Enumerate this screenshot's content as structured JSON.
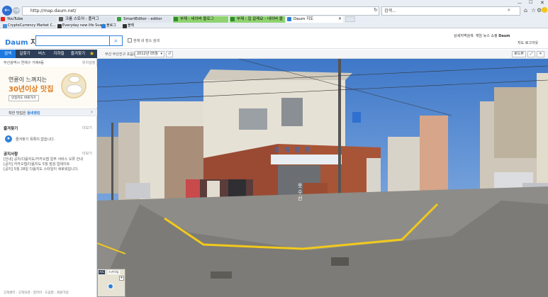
{
  "browser": {
    "address_url": "http://map.daum.net/",
    "search_placeholder": "검색...",
    "tabs": [
      {
        "label": "YouTube",
        "color": "#e62117"
      },
      {
        "label": "크롬 스토어 - 플러그",
        "color": "#555"
      },
      {
        "label": "SmartEditor - editor",
        "color": "#3ca03c"
      },
      {
        "label": "부제 : 네이버 블로그",
        "color": "#3ca03c"
      },
      {
        "label": "부제 : 집 갈래요 - 네이버 블",
        "color": "#3ca03c"
      },
      {
        "label": "Daum 지도",
        "color": "#2f7fd6"
      }
    ],
    "favorites": [
      {
        "label": "CryptoCurrency Market C...",
        "color": "#4a90d9"
      },
      {
        "label": "Everyday new life Svart",
        "color": "#333"
      },
      {
        "label": "블로그",
        "color": "#2f7fd6"
      },
      {
        "label": "블랙",
        "color": "#333"
      }
    ]
  },
  "daum": {
    "logo_prefix": "Daum",
    "logo_suffix": "지도",
    "checkbox_label": "현재 내 장소 검색",
    "nav_links": [
      "상세지역검색",
      "게임",
      "뉴스",
      "쇼핑",
      "Daum"
    ],
    "nav_links_2": [
      "지도",
      "로그아웃"
    ]
  },
  "sidebar": {
    "tabs": [
      "검색",
      "길찾기",
      "버스",
      "지하철",
      "즐겨찾기"
    ],
    "location": "부산광역시 연제구 거제4동",
    "location_link": "위치설정",
    "ad_line1": "연륜이 느껴지는",
    "ad_line2": "30년이상 맛집",
    "ad_button": "맛집지도 바로가기",
    "promo_text": "착한 맛집은",
    "promo_highlight": "동네랭킹",
    "favorites_title": "즐겨찾기",
    "favorites_more": "더보기",
    "favorites_empty": "즐겨찾기 목록이 없습니다.",
    "notice_title": "공지사항",
    "notice_more": "더보기",
    "notices": [
      "[안내] 공지/다음지도/카카오맵 일부 서비스 오류 안내",
      "[공지] 카카오맵/다음지도 5월 점검 업데이트",
      "[공지] 5월 28일 다음지도 스타일이 새로워집니다."
    ],
    "minimap_tabs": [
      "지도",
      "스카이뷰"
    ],
    "footer_links": [
      "고객센터",
      "고객의견",
      "알리미",
      "도움말",
      "회원가입"
    ]
  },
  "streetview": {
    "breadcrumb": "부산 부산진구 초읍동",
    "date_select": "2012년 05월",
    "right_button": "로드뷰",
    "signboard": "조 라 정 천 ",
    "shop_sign": "옷수선"
  }
}
